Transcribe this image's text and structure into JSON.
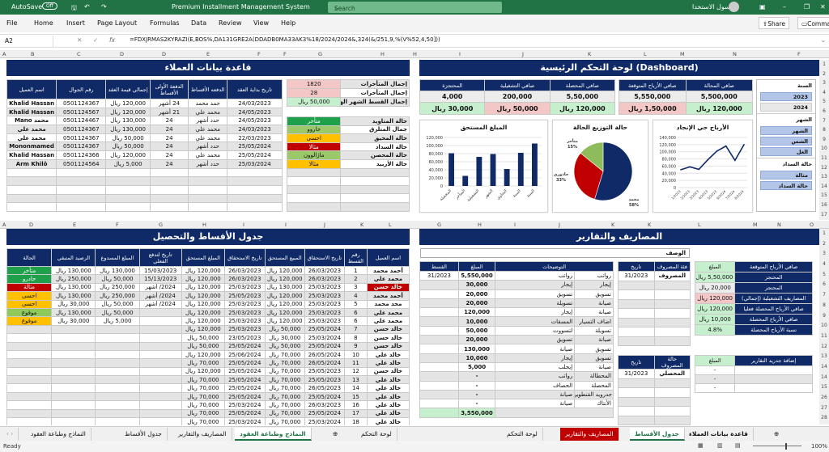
{
  "titlebar": {
    "autosave": "AutoSave",
    "autosave_state": "Off",
    "title": "Premium Installment Management System",
    "search": "Search",
    "user": "سول الاستخدا"
  },
  "menu": [
    "File",
    "Home",
    "Insert",
    "Page Layout",
    "Formulas",
    "Data",
    "Review",
    "View",
    "Help"
  ],
  "share": "Share",
  "comments": "Comma",
  "formula_bar": {
    "cell": "A2",
    "formula": "=FDXJRMAS2KYRAZI(E,BOS%,DA131GRE2A(DDADB0MA33AK3%18/2024/2024&,324(&/251,9,%(V%52,4,50]))"
  },
  "col_headers_top": [
    "A",
    "B",
    "C",
    "D",
    "D",
    "E",
    "F",
    "F",
    "G",
    "H",
    "H",
    "I",
    "J",
    "K",
    "L",
    "M",
    "N",
    "F"
  ],
  "col_headers_mid": [
    "A",
    "D",
    "E",
    "F",
    "G",
    "H",
    "I",
    "I",
    "J",
    "K",
    "L",
    "G",
    "H",
    "I",
    "J",
    "K",
    "K",
    "L",
    "M",
    "N",
    "O"
  ],
  "customers": {
    "title": "قاعدة بيانات العملاء",
    "headers": [
      "تاريخ بداية العقد",
      "الدفعه الأقساط",
      "الدفعة الأولى الأقساط",
      "إجمالي قيمة العقد",
      "رقم الجوال",
      "اسم العميل"
    ],
    "rows": [
      [
        "24/03/2023",
        "حمد محمد",
        "24 أشهر",
        "120,000 ريال",
        "0501124367",
        "Khalid Hassan"
      ],
      [
        "24/05/2023",
        "محمد علي",
        "21 أشهر",
        "120,000 ريال",
        "0501124567",
        "Khalid Hassan"
      ],
      [
        "24/05/2023",
        "حدد أشهر",
        "24",
        "130,000 ريال",
        "0501124467",
        "محمد Mano"
      ],
      [
        "24/03/2023",
        "محمد علي",
        "24",
        "130,000 ريال",
        "0501124367",
        "محمد علي"
      ],
      [
        "22/03/2023",
        "محمد علي",
        "24",
        "50,000 ريال",
        "0501124367",
        "محمد علي"
      ],
      [
        "25/05/2024",
        "حدد أشهر",
        "24",
        "50,000 ريال",
        "0501124367",
        "Mononmamed"
      ],
      [
        "25/05/2024",
        "محمد علي",
        "24",
        "120,000 ريال",
        "0501124366",
        "Khalid Hassan"
      ],
      [
        "25/03/2024",
        "حدد أشهر",
        "24",
        "5,000 ريال",
        "0501124564",
        "Arm Khilö"
      ]
    ]
  },
  "summary": {
    "rows": [
      [
        "إجمال المتأخرات",
        "1820"
      ],
      [
        "إجمال المتأخرات",
        "28"
      ],
      [
        "إجمال القسط الشهر الهري",
        "50,000 ريال"
      ]
    ],
    "fills": [
      "#f4c7c7",
      "#f4c7c7",
      "#c6efce"
    ]
  },
  "statuses": {
    "rows": [
      [
        "حالة المتاويد",
        "متأخر"
      ],
      [
        "جمال المتلرق",
        "حاروو"
      ],
      [
        "حالة المحيق",
        "احسى"
      ],
      [
        "حالة السداد",
        "مثالا"
      ],
      [
        "حالة المحصن",
        "ماژالوون"
      ],
      [
        "حالة الأربيد",
        "مثالا"
      ]
    ],
    "fills": [
      "#1fa04a",
      "#9bc96a",
      "#ffc000",
      "#c00000",
      "#9bc96a",
      "#ffc000"
    ]
  },
  "dashboard": {
    "title": "لوحة التحكم الرئيسية (Dashboard)",
    "kpi_a": {
      "headers": [
        "صافي المحصلة",
        "صافي التشغيلية",
        "المحتجزة"
      ],
      "values": [
        "5,50,000",
        "200,000",
        "4,000"
      ],
      "money": [
        "120,000 ريال",
        "50,000 ريال",
        "30,000 ريال"
      ],
      "fills": [
        "#c6efce",
        "#f4c7c7",
        "#c6efce"
      ]
    },
    "kpi_b": {
      "headers": [
        "صافي المحالة",
        "صافي الأرباح المتوقعة"
      ],
      "values": [
        "5,500,000",
        "5,550,000"
      ],
      "money": [
        "120,000 ريال",
        "1,50,000 ريال"
      ],
      "fills": [
        "#c6efce",
        "#f4c7c7"
      ]
    },
    "slicer": {
      "year_label": "السنة",
      "years": [
        "2023",
        "2024"
      ],
      "month_label": "الشهر",
      "months": [
        "الشهر",
        "الشس",
        "الغل"
      ],
      "pay_label": "حالة السداد",
      "pay": [
        "مثالة",
        "حالة السداد"
      ]
    }
  },
  "chart_data": [
    {
      "type": "bar",
      "title": "المبلغ المستحق",
      "categories": [
        "المحصلة",
        "المتأخر",
        "التشغيلية",
        "الشهر",
        "المتاوي",
        "السنة",
        "السنة"
      ],
      "values": [
        81000,
        25000,
        72000,
        79000,
        42000,
        82000,
        105000
      ],
      "ylim": [
        0,
        120000
      ],
      "yticks": [
        "0",
        "20,000",
        "40,000",
        "60,000",
        "80,000",
        "100,000",
        "120,000"
      ],
      "color": "#0f2a66"
    },
    {
      "type": "pie",
      "title": "حالة التوزيع الحالة",
      "labels": [
        "محمد",
        "حاذوري",
        "متأخر"
      ],
      "values": [
        58,
        33,
        15
      ],
      "pct_labels": [
        "58%",
        "33%",
        "15%"
      ],
      "colors": [
        "#0f2a66",
        "#c00000",
        "#8fbc5a"
      ]
    },
    {
      "type": "line",
      "title": "الأرباح حي الإنجاد",
      "x": [
        "1/2023",
        "2/2023",
        "3/2023",
        "4/2023",
        "5/2023",
        "6/2024",
        "7/2024",
        "8/2024"
      ],
      "values": [
        50000,
        58000,
        51000,
        78000,
        102000,
        116000,
        76000,
        120000
      ],
      "ylim": [
        0,
        140000
      ],
      "yticks": [
        "0",
        "20,000",
        "40,000",
        "60,000",
        "80,000",
        "100,000",
        "120,000",
        "140,000"
      ],
      "color": "#0f2a66"
    }
  ],
  "installments": {
    "title": "جدول الأقساط والتحصيل",
    "headers": [
      "اسم العميل",
      "رقم القسط",
      "تاريخ الاستحقاق",
      "المبيع المستحق",
      "تاريخ الاستحقاق",
      "المبلغ المستحق",
      "تاريخ لتدفع الفعلي",
      "المبلغ المسدوع",
      "الرصيد المتبقي",
      "الحالة"
    ],
    "rows": [
      [
        "أحمد محمد",
        "1",
        "26/03/2023",
        "120,000 ريال",
        "26/03/2023",
        "120,000 ريال",
        "15/03/2023",
        "130,000 ريال",
        "130,000 ريال",
        "متأخر"
      ],
      [
        "محمد علي",
        "2",
        "26/03/2023",
        "120,000 ريال",
        "26/03/2023",
        "120,000 ريال",
        "15/13/2023",
        "50,000 ريال",
        "250,000 ريال",
        "حادرو"
      ],
      [
        "خالد حسن",
        "3",
        "25/03/2023",
        "130,000 ريال",
        "25/03/2023",
        "120,000 ريال",
        "2024/ أشهر",
        "250,000 ريال",
        "130,000 ريال",
        "مثالة"
      ],
      [
        "أحمد محمد",
        "4",
        "25/03/2023",
        "120,000 ريال",
        "25/05/2023",
        "120,000 ريال",
        "2024/ أشهر",
        "250,000 ريال",
        "130,000 ريال",
        "احسى"
      ],
      [
        "محد محمد",
        "5",
        "25/03/2023",
        "120,000 ريال",
        "25/03/2023",
        "120,000 ريال",
        "2024/ أشهر",
        "50,000 ريال",
        "30,000 ريال",
        "احسى"
      ],
      [
        "محمد علي",
        "6",
        "25/03/2023",
        "120,000 ريال",
        "25/03/2023",
        "120,000 ريال",
        "",
        "50,000 ريال",
        "130,000 ريال",
        "موقوع"
      ],
      [
        "محمد علي",
        "6",
        "25/03/2023",
        "120,000 ريال",
        "25/03/2023",
        "120,000 ريال",
        "",
        "5,000 ريال",
        "30,000 ريال",
        "موقوع"
      ],
      [
        "خالد حسن",
        "7",
        "25/05/2024",
        "50,000 ريال",
        "25/03/2023",
        "120,000 ريال",
        "",
        "",
        "",
        ""
      ],
      [
        "خالد حسن",
        "8",
        "25/03/2024",
        "30,000 ريال",
        "23/05/2023",
        "50,000 ريال",
        "",
        "",
        "",
        ""
      ],
      [
        "خالد حسن",
        "9",
        "25/05/2024",
        "50,000 ريال",
        "25/05/2024",
        "50,000 ريال",
        "",
        "",
        "",
        ""
      ],
      [
        "خالد علي",
        "10",
        "26/05/2024",
        "70,000 ريال",
        "25/06/2024",
        "120,000 ريال",
        "",
        "",
        "",
        ""
      ],
      [
        "خالد علي",
        "11",
        "26/05/2024",
        "70,000 ريال",
        "25/05/2024",
        "70,000 ريال",
        "",
        "",
        "",
        ""
      ],
      [
        "خالد حسن",
        "12",
        "25/05/2023",
        "70,000 ريال",
        "25/05/2024",
        "120,000 ريال",
        "",
        "",
        "",
        ""
      ],
      [
        "خالد علي",
        "13",
        "25/05/2023",
        "70,000 ريال",
        "25/05/2024",
        "70,000 ريال",
        "",
        "",
        "",
        ""
      ],
      [
        "خالد علي",
        "14",
        "26/05/2023",
        "70,000 ريال",
        "25/05/2024",
        "70,000 ريال",
        "",
        "",
        "",
        ""
      ],
      [
        "خالد علي",
        "15",
        "25/05/2024",
        "70,000 ريال",
        "25/05/2024",
        "70,000 ريال",
        "",
        "",
        "",
        ""
      ],
      [
        "خالد علي",
        "16",
        "26/03/2023",
        "70,000 ريال",
        "25/03/2024",
        "70,000 ريال",
        "",
        "",
        "",
        ""
      ],
      [
        "خالد علي",
        "17",
        "25/05/2024",
        "70,000 ريال",
        "25/05/2024",
        "70,000 ريال",
        "",
        "",
        "",
        ""
      ],
      [
        "خالد علي",
        "18",
        "25/03/2024",
        "70,000 ريال",
        "25/03/2024",
        "70,000 ريال",
        "",
        "",
        "",
        ""
      ]
    ],
    "status_fills": [
      "#1fa04a",
      "#1fa04a",
      "#c00000",
      "#ffc000",
      "#ffc000",
      "#8fc95a",
      "#ffc000"
    ],
    "name_fills": [
      "",
      "",
      "#c00000"
    ]
  },
  "expenses": {
    "title": "المصاريف والتقارير",
    "description_label": "الوصف",
    "headers": [
      "التوضيحات",
      "المبلغ",
      "القسط"
    ],
    "rows": [
      [
        "رواتب",
        "رواتب",
        "5,550,000",
        "31/2023"
      ],
      [
        "إيجار",
        "إيجار",
        "30,000",
        ""
      ],
      [
        "تسويق",
        "تسويق",
        "20,000",
        ""
      ],
      [
        "صيانة",
        "تسويلة",
        "20,000",
        ""
      ],
      [
        "صيانة",
        "إيجار",
        "120,000",
        ""
      ],
      [
        "اضاف التسيار",
        "المسقات",
        "10,000",
        ""
      ],
      [
        "تسويلة",
        "لتسووت",
        "50,000",
        ""
      ],
      [
        "صيانة",
        "تسويق",
        "20,000",
        ""
      ],
      [
        "تسويق",
        "صيانة",
        "130,000",
        ""
      ],
      [
        "تسويق",
        "إيجار",
        "10,000",
        ""
      ],
      [
        "صيانة",
        "إيجلب",
        "5,000",
        ""
      ],
      [
        "المحطالة",
        "رواتب",
        "-",
        ""
      ],
      [
        "المحصلة",
        "الحصاف",
        "-",
        ""
      ],
      [
        "جدرويد القنطوين",
        "صيانة",
        "-",
        ""
      ],
      [
        "الأنتاك",
        "صيانة",
        "-",
        ""
      ]
    ],
    "total": "3,550,000",
    "category": {
      "headers": [
        "فئة المصروف",
        "تاريخ"
      ],
      "rows": [
        [
          "المصروف",
          "31/2023"
        ]
      ]
    },
    "state": {
      "headers": [
        "حالة المصروف",
        "تاريخ"
      ],
      "rows": [
        [
          "المحصلي",
          "31/2023"
        ]
      ]
    },
    "kpis": {
      "headers": [
        "صافي الأرباح المتوقعة",
        "المبلغ"
      ],
      "rows": [
        [
          "المحتجز",
          "5,50,000 ريال"
        ],
        [
          "المحتجز",
          "20,000 ريال"
        ],
        [
          "المصاريف التشغيلية (إجمالي)",
          "120,000 ريال"
        ],
        [
          "صافي الأرباح المحصلة فعليا",
          "120,000 ريال"
        ],
        [
          "صافي الأرباح المحصلة",
          "10,000 ريال"
        ],
        [
          "نسبة الأرباح المحصلة",
          "4.8%"
        ]
      ],
      "fills": [
        "#c6efce",
        "#ececec",
        "#f4c7c7",
        "#c6efce",
        "#c6efce",
        "#c6efce"
      ]
    },
    "reports": {
      "headers": [
        "إضافة جدريد التقارير",
        "المبلغ"
      ],
      "rows": [
        [
          "",
          "-"
        ],
        [
          "",
          "-"
        ],
        [
          "",
          "-"
        ]
      ]
    }
  },
  "row_numbers_top": [
    "1",
    "2",
    "3",
    "4",
    "5",
    "6",
    "7",
    "8",
    "9",
    "10",
    "11",
    "12",
    "13",
    "14",
    "15",
    "16",
    "17"
  ],
  "row_numbers_bottom": [
    "1",
    "2",
    "3",
    "4",
    "5",
    "6",
    "7",
    "8",
    "9",
    "10",
    "11",
    "12",
    "13",
    "14",
    "14",
    "15",
    "26",
    "27",
    "28"
  ],
  "sheet_tabs_left": [
    "النماذج وطباعة العقود",
    "جدول الأقساط",
    "المصاريف والتقارير",
    "النماذج وطباعة العقود",
    "لوحة التحكم"
  ],
  "sheet_tabs_right": [
    "لوحة التحكم",
    "المصاريف والتقارير",
    "جدول الأقساط",
    "قاعدة بيانات العملاء"
  ],
  "status": {
    "ready": "Ready",
    "zoom": "100%"
  }
}
